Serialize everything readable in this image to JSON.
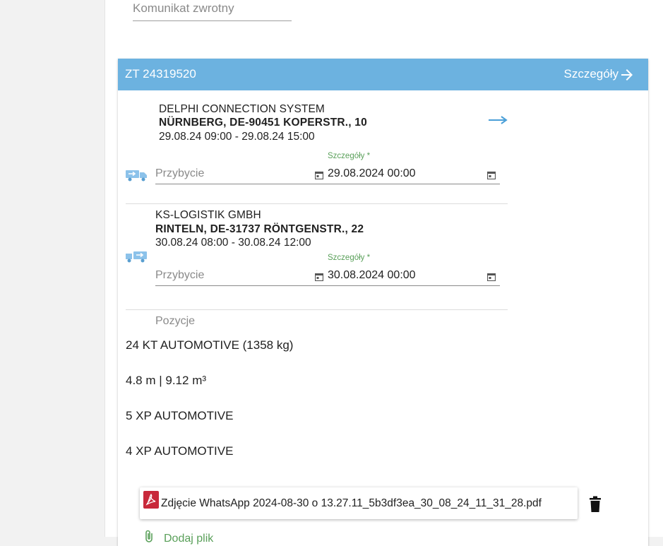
{
  "feedback": {
    "placeholder": "Komunikat zwrotny"
  },
  "order": {
    "number": "ZT 24319520",
    "details_label": "Szczegóły"
  },
  "stops": [
    {
      "company": "DELPHI CONNECTION SYSTEM",
      "address": "NÜRNBERG, DE-90451 KOPERSTR., 10",
      "time_window": "29.08.24 09:00 - 29.08.24 15:00",
      "arrival_placeholder": "Przybycie",
      "field_label": "Szczegóły *",
      "field_value": "29.08.2024 00:00",
      "icon": "truck-loading-icon"
    },
    {
      "company": "KS-LOGISTIK GMBH",
      "address": "RINTELN, DE-31737 RÖNTGENSTR., 22",
      "time_window": "30.08.24 08:00 - 30.08.24 12:00",
      "arrival_placeholder": "Przybycie",
      "field_label": "Szczegóły *",
      "field_value": "30.08.2024 00:00",
      "icon": "truck-unloading-icon"
    }
  ],
  "positions": {
    "label": "Pozycje",
    "items": [
      "24 KT AUTOMOTIVE (1358 kg)",
      "4.8 m | 9.12 m³",
      "5 XP AUTOMOTIVE",
      "4 XP AUTOMOTIVE"
    ]
  },
  "attachment": {
    "filename": "Zdjęcie WhatsApp 2024-08-30 o 13.27.11_5b3df3ea_30_08_24_11_31_28.pdf",
    "icon": "pdf-icon"
  },
  "add_attachment": {
    "label": "Dodaj plik"
  },
  "colors": {
    "header_bg": "#6cb2e0",
    "accent_green": "#5aa05a",
    "pdf_red": "#c8283a",
    "link_blue": "#4a9fd8"
  }
}
